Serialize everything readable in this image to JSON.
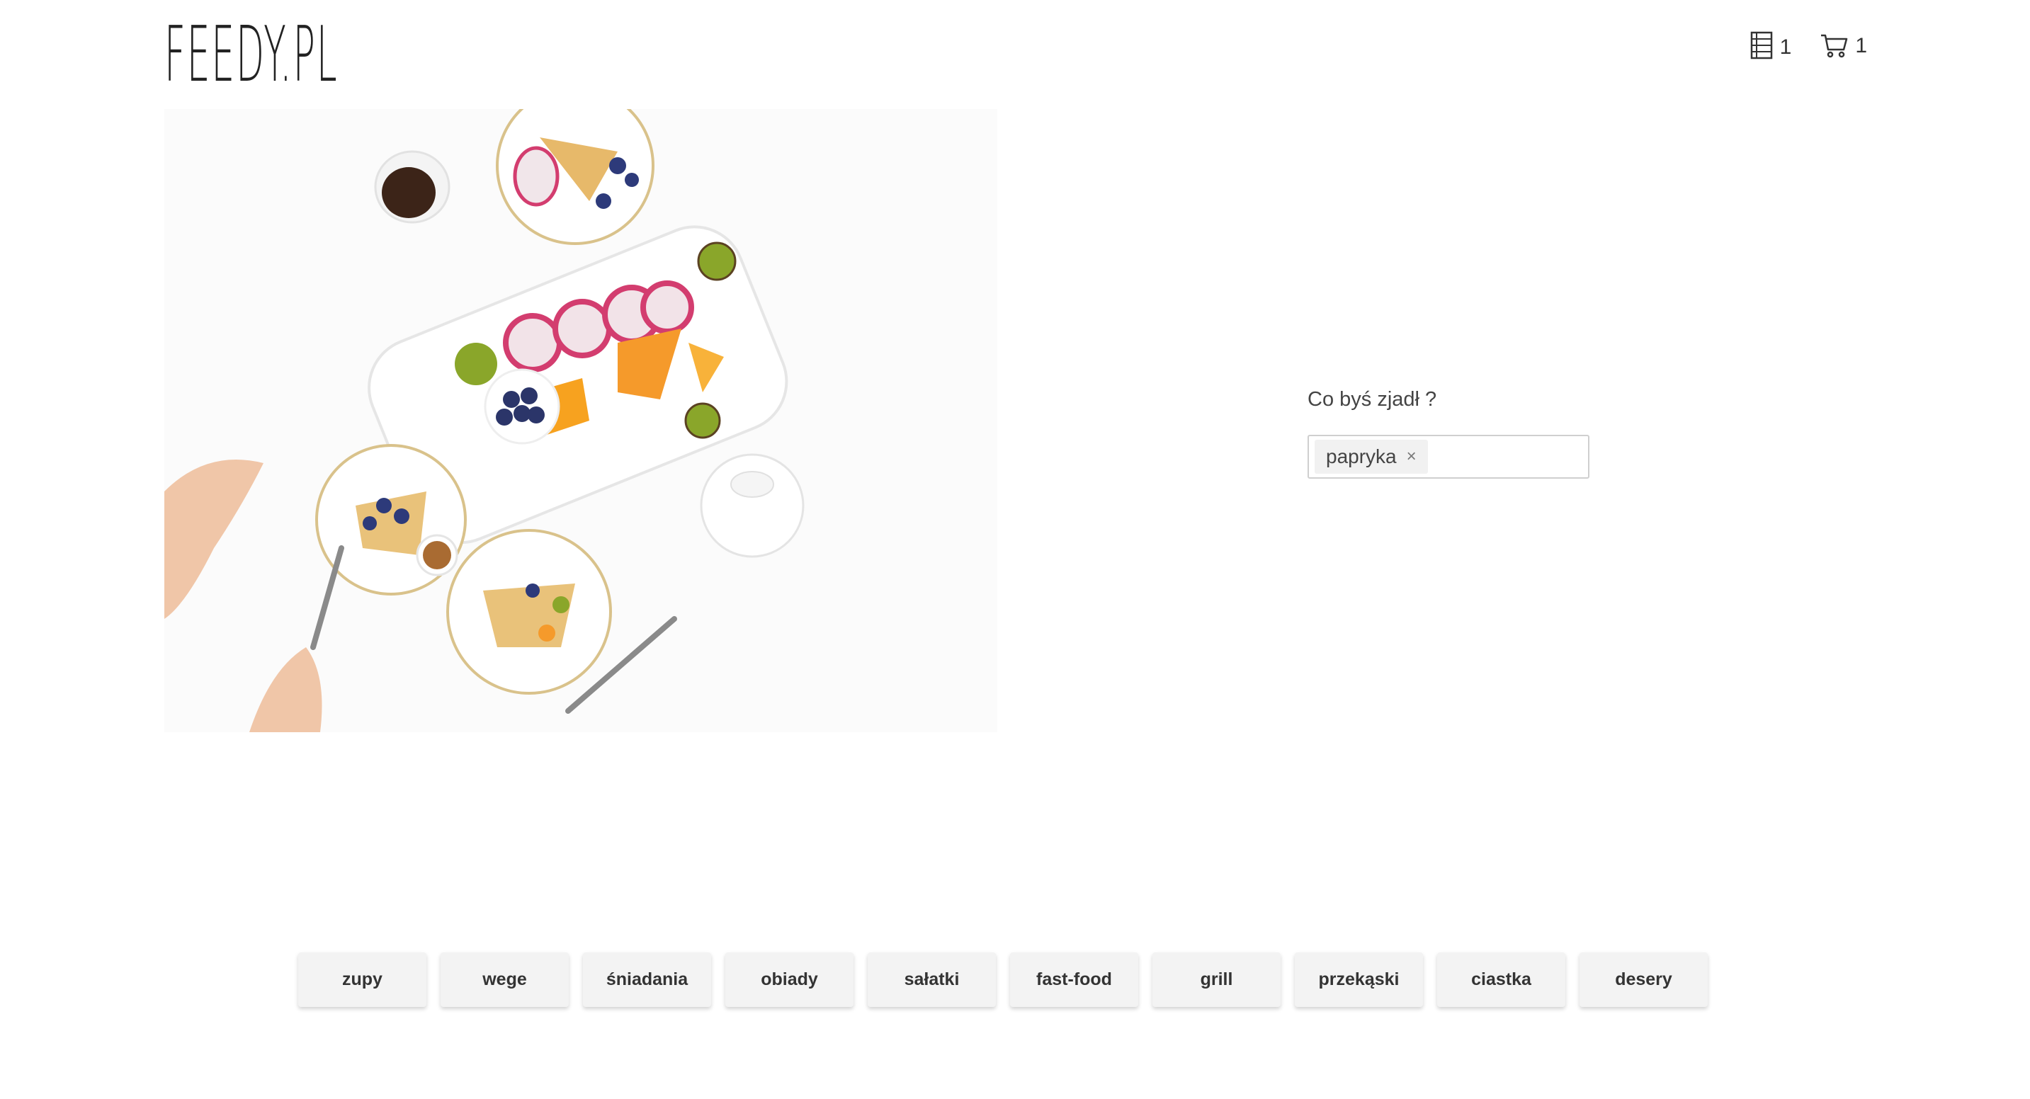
{
  "header": {
    "logo": "FEEDY.PL",
    "list_count": "1",
    "cart_count": "1"
  },
  "hero": {
    "icon": "food-flatlay-image"
  },
  "search": {
    "label": "Co byś zjadł ?",
    "tags": [
      "papryka"
    ],
    "remove_symbol": "×"
  },
  "categories": [
    "zupy",
    "wege",
    "śniadania",
    "obiady",
    "sałatki",
    "fast-food",
    "grill",
    "przekąski",
    "ciastka",
    "desery"
  ],
  "colors": {
    "background": "#ffffff",
    "button_bg": "#f3f3f3",
    "text": "#333333",
    "chip_bg": "#f1f1f1"
  }
}
